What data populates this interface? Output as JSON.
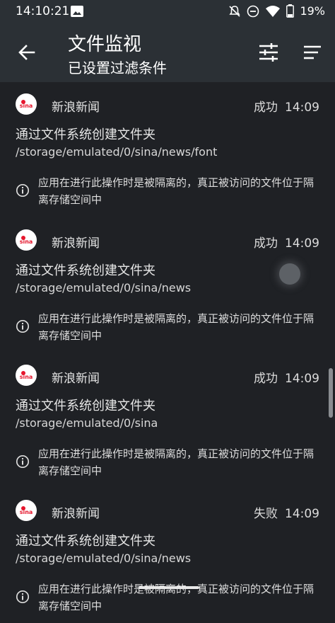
{
  "status_bar": {
    "time": "14:10:21",
    "battery": "19%",
    "icons": [
      "photo-icon",
      "mute-icon",
      "dnd-icon",
      "wifi-icon",
      "battery-icon"
    ]
  },
  "header": {
    "title": "文件监视",
    "subtitle": "已设置过滤条件",
    "icons": [
      "back-arrow-icon",
      "filter-sliders-icon",
      "sort-icon"
    ]
  },
  "entries": [
    {
      "app": "新浪新闻",
      "status": "成功",
      "time": "14:09",
      "action": "通过文件系统创建文件夹",
      "path": "/storage/emulated/0/sina/news/font",
      "note": "应用在进行此操作时是被隔离的，真正被访问的文件位于隔离存储空间中"
    },
    {
      "app": "新浪新闻",
      "status": "成功",
      "time": "14:09",
      "action": "通过文件系统创建文件夹",
      "path": "/storage/emulated/0/sina/news",
      "note": "应用在进行此操作时是被隔离的，真正被访问的文件位于隔离存储空间中"
    },
    {
      "app": "新浪新闻",
      "status": "成功",
      "time": "14:09",
      "action": "通过文件系统创建文件夹",
      "path": "/storage/emulated/0/sina",
      "note": "应用在进行此操作时是被隔离的，真正被访问的文件位于隔离存储空间中"
    },
    {
      "app": "新浪新闻",
      "status": "失败",
      "time": "14:09",
      "action": "通过文件系统创建文件夹",
      "path": "/storage/emulated/0/sina/news",
      "note": "应用在进行此操作时是被隔离的，真正被访问的文件位于隔离存储空间中"
    }
  ],
  "logo_text": "sina"
}
